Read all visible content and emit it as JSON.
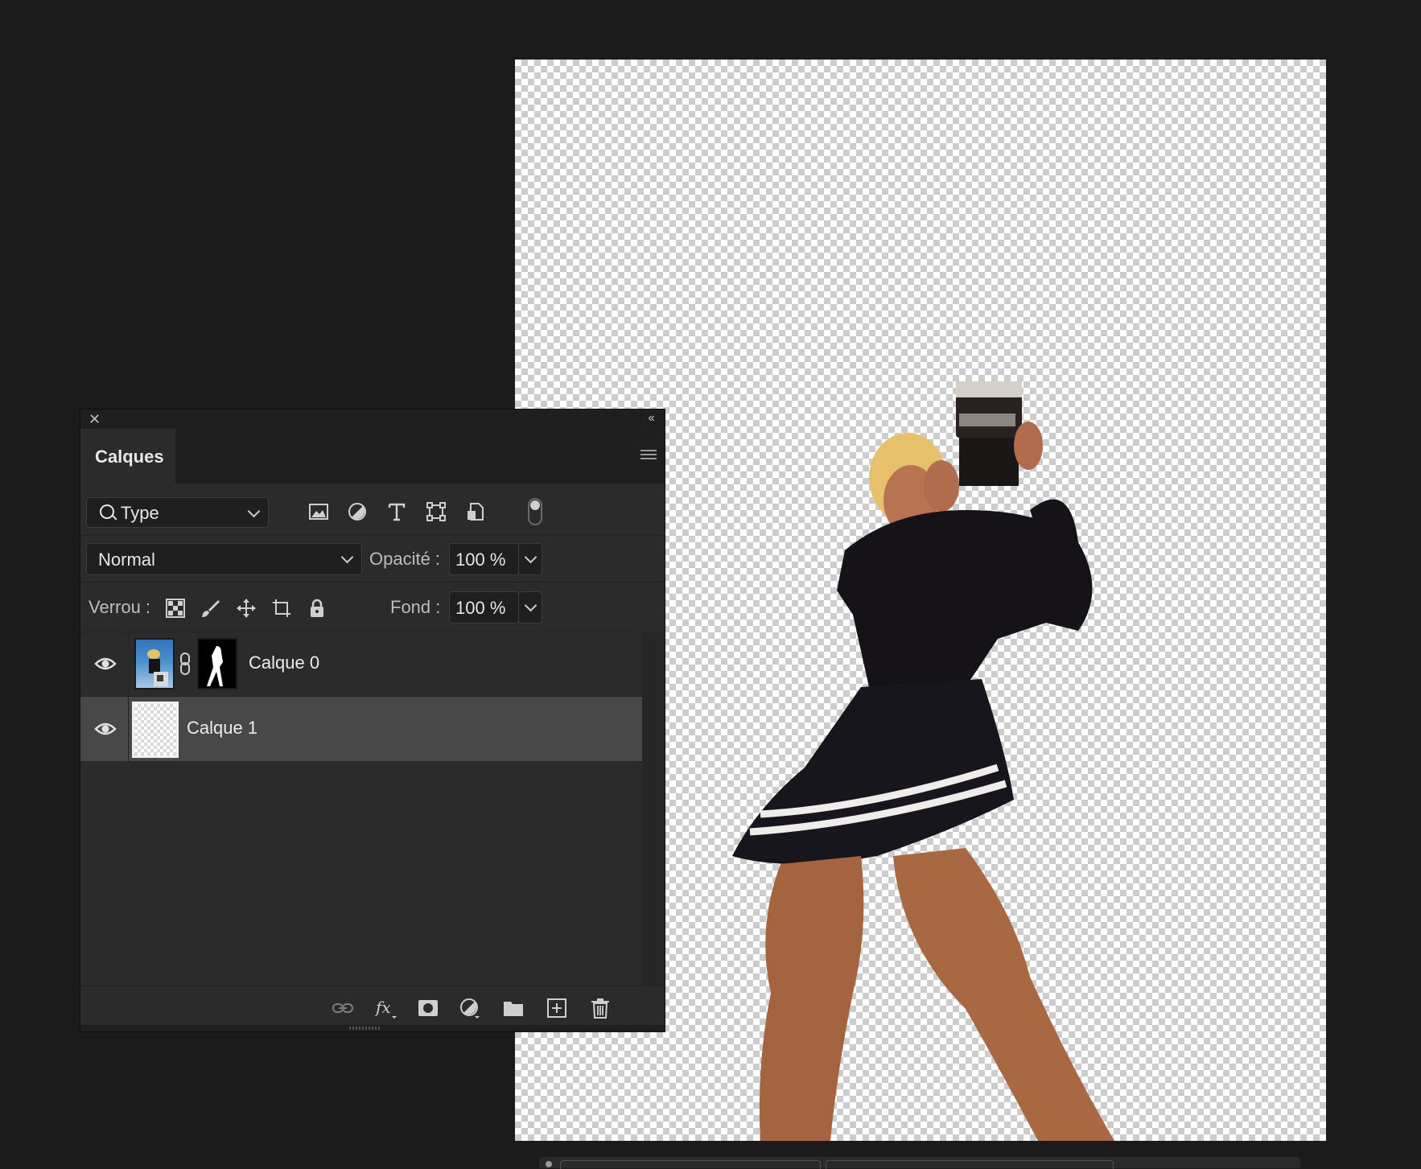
{
  "panel": {
    "tab_label": "Calques",
    "filter": {
      "label": "Type"
    },
    "blend": {
      "mode": "Normal",
      "opacity_label": "Opacité :",
      "opacity_value": "100 %"
    },
    "lock": {
      "label": "Verrou :",
      "fill_label": "Fond :",
      "fill_value": "100 %"
    },
    "layers": [
      {
        "name": "Calque 0",
        "visible": true,
        "selected": false,
        "has_mask": true
      },
      {
        "name": "Calque 1",
        "visible": true,
        "selected": true,
        "has_mask": false
      }
    ],
    "footer_icons": [
      "link-layers-icon",
      "fx-icon",
      "add-mask-icon",
      "adjustment-layer-icon",
      "group-folder-icon",
      "new-layer-icon",
      "trash-icon"
    ]
  },
  "colors": {
    "app_background": "#1b1b1b",
    "panel_background": "#2b2b2b",
    "selected_layer": "#484848"
  }
}
